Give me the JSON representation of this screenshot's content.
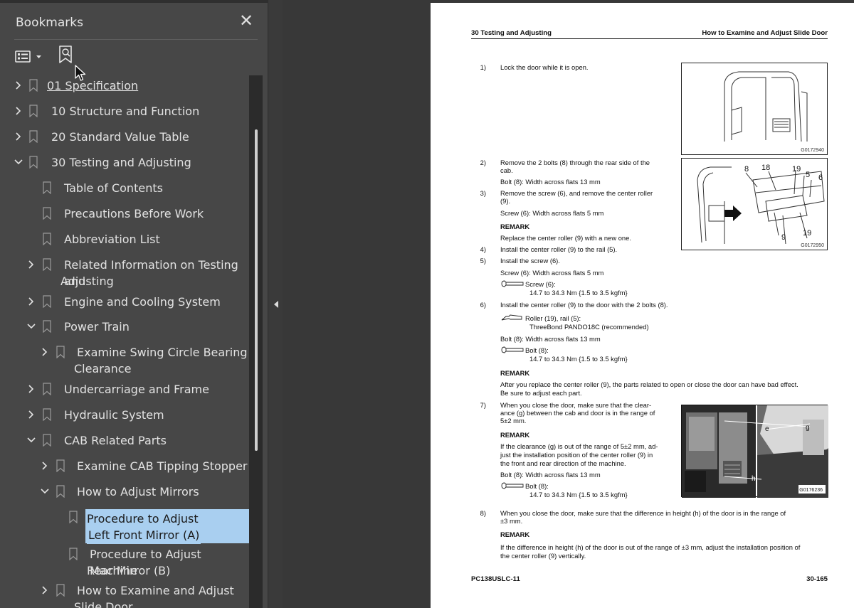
{
  "sidebar": {
    "title": "Bookmarks",
    "close_label": "✕",
    "items": [
      {
        "label": "01 Specification",
        "expand": "collapsed"
      },
      {
        "label": "10 Structure and Function",
        "expand": "collapsed"
      },
      {
        "label": "20 Standard Value Table",
        "expand": "collapsed"
      },
      {
        "label": "30 Testing and Adjusting",
        "expand": "expanded"
      },
      {
        "label": "Table of Contents",
        "expand": "none"
      },
      {
        "label": "Precautions Before Work",
        "expand": "none"
      },
      {
        "label": "Abbreviation List",
        "expand": "none"
      },
      {
        "label": "Related Information on Testing and",
        "label2": "Adjusting",
        "expand": "collapsed"
      },
      {
        "label": "Engine and Cooling System",
        "expand": "collapsed"
      },
      {
        "label": "Power Train",
        "expand": "expanded"
      },
      {
        "label": "Examine Swing Circle Bearing",
        "label2": "Clearance",
        "expand": "collapsed"
      },
      {
        "label": "Undercarriage and Frame",
        "expand": "collapsed"
      },
      {
        "label": "Hydraulic System",
        "expand": "collapsed"
      },
      {
        "label": "CAB Related Parts",
        "expand": "expanded"
      },
      {
        "label": "Examine CAB Tipping Stopper",
        "expand": "collapsed"
      },
      {
        "label": "How to Adjust Mirrors",
        "expand": "expanded"
      },
      {
        "label": "Procedure to Adjust Machine",
        "label2": "Left Front Mirror (A)",
        "expand": "none",
        "selected": true
      },
      {
        "label": "Procedure to Adjust Machine",
        "label2": "Rear Mirror (B)",
        "expand": "none"
      },
      {
        "label": "How to Examine and Adjust",
        "label2": "Slide Door",
        "expand": "collapsed"
      }
    ]
  },
  "page": {
    "header_left": "30 Testing and Adjusting",
    "header_right": "How to Examine and Adjust Slide Door",
    "step1_num": "1)",
    "step1": "Lock the door while it is open.",
    "fig1_id": "G0172940",
    "step2_num": "2)",
    "step2_l1": "Remove the 2 bolts (8) through the rear side of the",
    "step2_l2": "cab.",
    "step2_bolt": "Bolt (8): Width across flats 13 mm",
    "step3_num": "3)",
    "step3_l1": "Remove the screw (6), and remove the center roller",
    "step3_l2": "(9).",
    "step3_screw": "Screw (6): Width across flats 5 mm",
    "remark": "REMARK",
    "remark1": "Replace the center roller (9) with a new one.",
    "fig2_id": "G0172950",
    "fig2_labels": [
      "8",
      "18",
      "19",
      "5",
      "6",
      "9",
      "19"
    ],
    "step4_num": "4)",
    "step4": "Install the center roller (9) to the rail (5).",
    "step5_num": "5)",
    "step5": "Install the screw (6).",
    "step5_screw": "Screw (6): Width across flats 5 mm",
    "torque_screw_label": "Screw (6):",
    "torque_value": "14.7 to 34.3 Nm {1.5 to 3.5 kgfm}",
    "step6_num": "6)",
    "step6": "Install the center roller (9) to the door with the 2 bolts (8).",
    "adhesive_label": "Roller (19), rail (5):",
    "adhesive_value": "ThreeBond PANDO18C (recommended)",
    "step6_bolt": "Bolt (8): Width across flats 13 mm",
    "torque_bolt_label": "Bolt (8):",
    "remark2_l1": "After you replace the center roller (9), the parts related to open or close the door can have bad effect.",
    "remark2_l2": "Be sure to adjust each part.",
    "step7_num": "7)",
    "step7_l1": "When you close the door, make sure that the clear-",
    "step7_l2": "ance (g) between the cab and door is in the range of",
    "step7_l3": "5±2 mm.",
    "remark3_l1": "If the clearance (g) is out of the range of 5±2 mm, ad-",
    "remark3_l2": "just the installation position of the center roller (9) in",
    "remark3_l3": "the front and rear direction of the machine.",
    "step7_bolt": "Bolt (8): Width across flats 13 mm",
    "fig3_id": "G0176236",
    "fig3_labels": [
      "e",
      "g",
      "h"
    ],
    "step8_num": "8)",
    "step8_l1": "When you close the door, make sure that the difference in height (h) of the door is in the range of",
    "step8_l2": "±3 mm.",
    "remark4_l1": "If the difference in height (h) of the door is out of the range of ±3 mm, adjust the installation position of",
    "remark4_l2": "the center roller (9) vertically.",
    "footer_left": "PC138USLC-11",
    "footer_right": "30-165"
  },
  "colors": {
    "sidebar_bg": "#474747",
    "viewer_bg": "#383838",
    "selected_bg": "#a9cff0",
    "text_light": "#e2e2e2"
  }
}
